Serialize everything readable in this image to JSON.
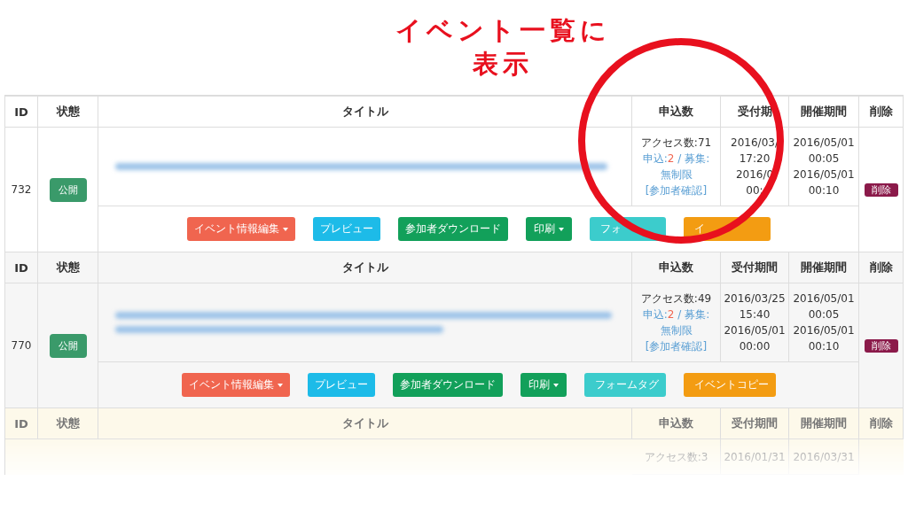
{
  "annotation": {
    "lines": [
      "イベント一覧に",
      "表示"
    ]
  },
  "events": [
    {
      "highlighted": false,
      "faded": false,
      "headers": [
        "ID",
        "状態",
        "タイトル",
        "申込数",
        "受付期",
        "開催期間",
        "削除"
      ],
      "id": "732",
      "status": "公開",
      "title_wraps": false,
      "access": "アクセス数:71",
      "applied_label": "申込:",
      "applied_count": "2",
      "capacity": "/ 募集: 無制限",
      "participants_link": "[参加者確認]",
      "reception": [
        "2016/03/",
        "17:20",
        "2016/0",
        "00:"
      ],
      "period": [
        "2016/05/01",
        "00:05",
        "2016/05/01",
        "00:10"
      ],
      "delete": "削除",
      "buttons": [
        {
          "kind": "edit",
          "label": "イベント情報編集",
          "caret": true
        },
        {
          "kind": "preview",
          "label": "プレビュー",
          "caret": false
        },
        {
          "kind": "download",
          "label": "参加者ダウンロード",
          "caret": false
        },
        {
          "kind": "print",
          "label": "印刷",
          "caret": true
        },
        {
          "kind": "formtag",
          "label": "フォ",
          "caret": false
        },
        {
          "kind": "copy",
          "label": "イ",
          "caret": false
        }
      ]
    },
    {
      "highlighted": false,
      "faded": false,
      "headers": [
        "ID",
        "状態",
        "タイトル",
        "申込数",
        "受付期間",
        "開催期間",
        "削除"
      ],
      "id": "770",
      "status": "公開",
      "title_wraps": true,
      "access": "アクセス数:49",
      "applied_label": "申込:",
      "applied_count": "2",
      "capacity": "/ 募集: 無制限",
      "participants_link": "[参加者確認]",
      "reception": [
        "2016/03/25",
        "15:40",
        "2016/05/01",
        "00:00"
      ],
      "period": [
        "2016/05/01",
        "00:05",
        "2016/05/01",
        "00:10"
      ],
      "delete": "削除",
      "buttons": [
        {
          "kind": "edit",
          "label": "イベント情報編集",
          "caret": true
        },
        {
          "kind": "preview",
          "label": "プレビュー",
          "caret": false
        },
        {
          "kind": "download",
          "label": "参加者ダウンロード",
          "caret": false
        },
        {
          "kind": "print",
          "label": "印刷",
          "caret": true
        },
        {
          "kind": "formtag",
          "label": "フォームタグ",
          "caret": false
        },
        {
          "kind": "copy",
          "label": "イベントコピー",
          "caret": false
        }
      ]
    },
    {
      "highlighted": true,
      "faded": true,
      "headers": [
        "ID",
        "状態",
        "タイトル",
        "申込数",
        "受付期間",
        "開催期間",
        "削除"
      ],
      "access": "アクセス数:3",
      "reception": [
        "2016/01/31"
      ],
      "period": [
        "2016/03/31"
      ]
    }
  ]
}
